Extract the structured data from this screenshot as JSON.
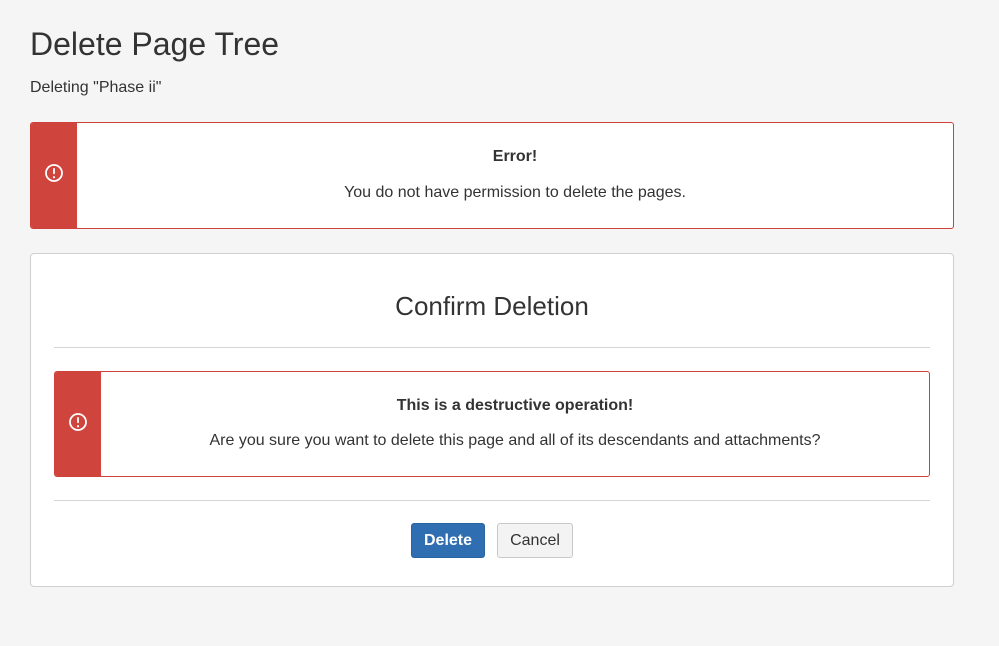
{
  "page": {
    "title": "Delete Page Tree",
    "subtitle": "Deleting \"Phase ii\""
  },
  "error_alert": {
    "icon": "exclamation-circle-icon",
    "heading": "Error!",
    "message": "You do not have permission to delete the pages.",
    "accent_color": "#d0443e"
  },
  "confirm_panel": {
    "title": "Confirm Deletion",
    "warning": {
      "icon": "exclamation-circle-icon",
      "heading": "This is a destructive operation!",
      "message": "Are you sure you want to delete this page and all of its descendants and attachments?",
      "accent_color": "#d0443e"
    },
    "delete_label": "Delete",
    "cancel_label": "Cancel",
    "primary_color": "#2f6fb1"
  }
}
